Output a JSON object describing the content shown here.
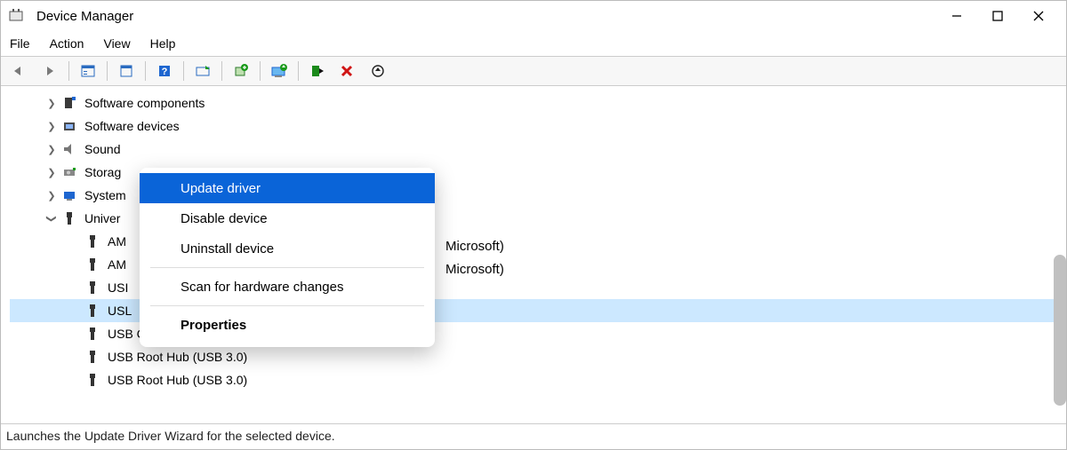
{
  "window": {
    "title": "Device Manager"
  },
  "menu": {
    "file": "File",
    "action": "Action",
    "view": "View",
    "help": "Help"
  },
  "toolbar_icons": {
    "back": "back-icon",
    "forward": "forward-icon",
    "show_hide": "show-hide-icon",
    "properties": "properties-icon",
    "help": "help-icon",
    "scan": "scan-icon",
    "add_legacy": "add-legacy-icon",
    "update_driver": "update-driver-icon",
    "disable": "disable-device-icon",
    "uninstall": "uninstall-icon",
    "scan_changes": "scan-changes-icon"
  },
  "tree": {
    "nodes": [
      {
        "label": "Software components",
        "icon": "software-components-icon",
        "expanded": false,
        "level": 1
      },
      {
        "label": "Software devices",
        "icon": "software-devices-icon",
        "expanded": false,
        "level": 1
      },
      {
        "label": "Sound",
        "icon": "sound-icon",
        "expanded": false,
        "level": 1,
        "truncated": true
      },
      {
        "label": "Storag",
        "icon": "storage-icon",
        "expanded": false,
        "level": 1,
        "truncated": true
      },
      {
        "label": "System",
        "icon": "system-icon",
        "expanded": false,
        "level": 1,
        "truncated": true
      },
      {
        "label": "Univer",
        "icon": "usb-controller-icon",
        "expanded": true,
        "level": 1,
        "truncated": true
      }
    ],
    "children": [
      {
        "label": "AM",
        "icon": "usb-device-icon",
        "truncated": true,
        "after": "Microsoft)"
      },
      {
        "label": "AM",
        "icon": "usb-device-icon",
        "truncated": true,
        "after": "Microsoft)"
      },
      {
        "label": "USI",
        "icon": "usb-device-icon",
        "truncated": true
      },
      {
        "label": "USL",
        "icon": "usb-device-icon",
        "truncated": true,
        "selected": true
      },
      {
        "label": "USB Composite Device",
        "icon": "usb-device-icon"
      },
      {
        "label": "USB Root Hub (USB 3.0)",
        "icon": "usb-device-icon"
      },
      {
        "label": "USB Root Hub (USB 3.0)",
        "icon": "usb-device-icon"
      }
    ]
  },
  "context_menu": {
    "items": [
      {
        "label": "Update driver",
        "highlight": true
      },
      {
        "label": "Disable device"
      },
      {
        "label": "Uninstall device"
      },
      {
        "sep": true
      },
      {
        "label": "Scan for hardware changes"
      },
      {
        "sep": true
      },
      {
        "label": "Properties",
        "bold": true
      }
    ]
  },
  "status": {
    "text": "Launches the Update Driver Wizard for the selected device."
  }
}
